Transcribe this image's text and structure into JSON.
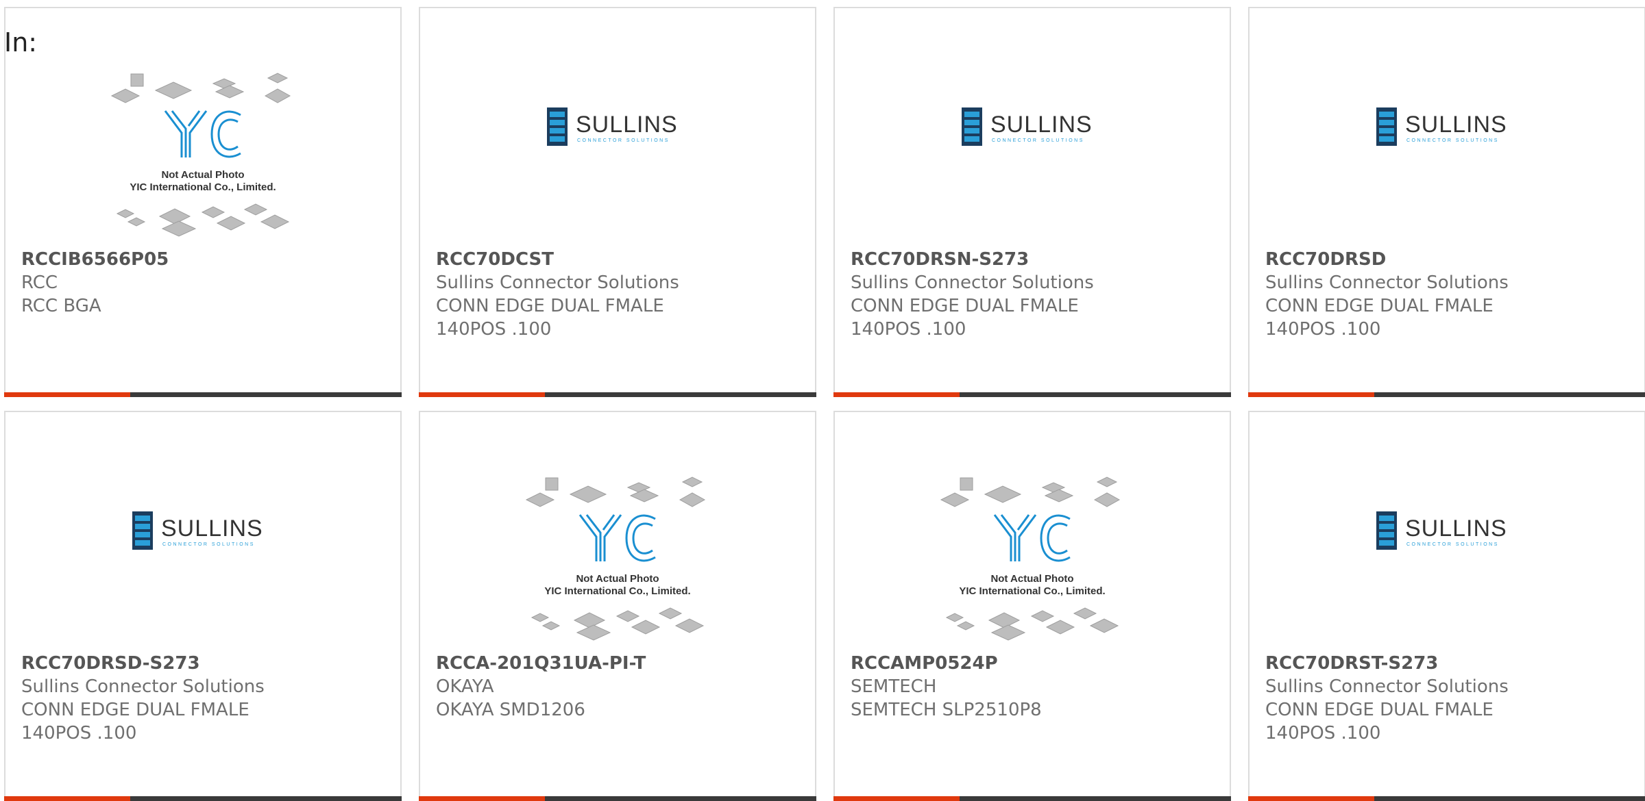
{
  "in_label": "In:",
  "colors": {
    "accent": "#e0390e",
    "bar_dark": "#3a3a3a",
    "border": "#dcdcdc",
    "sullins_blue": "#1a8fd1"
  },
  "placeholder": {
    "line1": "Not Actual Photo",
    "line2": "YIC International Co., Limited."
  },
  "sullins_logo": {
    "brand": "SULLINS",
    "tagline": "CONNECTOR SOLUTIONS"
  },
  "products": [
    {
      "pn": "RCCIB6566P05",
      "lines": [
        "RCC",
        "RCC BGA"
      ],
      "image": "yic-placeholder"
    },
    {
      "pn": "RCC70DCST",
      "lines": [
        "Sullins Connector Solutions",
        "CONN EDGE DUAL FMALE",
        "140POS .100"
      ],
      "image": "sullins-logo"
    },
    {
      "pn": "RCC70DRSN-S273",
      "lines": [
        "Sullins Connector Solutions",
        "CONN EDGE DUAL FMALE",
        "140POS .100"
      ],
      "image": "sullins-logo"
    },
    {
      "pn": "RCC70DRSD",
      "lines": [
        "Sullins Connector Solutions",
        "CONN EDGE DUAL FMALE",
        "140POS .100"
      ],
      "image": "sullins-logo"
    },
    {
      "pn": "RCC70DRSD-S273",
      "lines": [
        "Sullins Connector Solutions",
        "CONN EDGE DUAL FMALE",
        "140POS .100"
      ],
      "image": "sullins-logo"
    },
    {
      "pn": "RCCA-201Q31UA-PI-T",
      "lines": [
        "OKAYA",
        "OKAYA SMD1206"
      ],
      "image": "yic-placeholder"
    },
    {
      "pn": "RCCAMP0524P",
      "lines": [
        "SEMTECH",
        "SEMTECH SLP2510P8"
      ],
      "image": "yic-placeholder"
    },
    {
      "pn": "RCC70DRST-S273",
      "lines": [
        "Sullins Connector Solutions",
        "CONN EDGE DUAL FMALE",
        "140POS .100"
      ],
      "image": "sullins-logo"
    }
  ]
}
